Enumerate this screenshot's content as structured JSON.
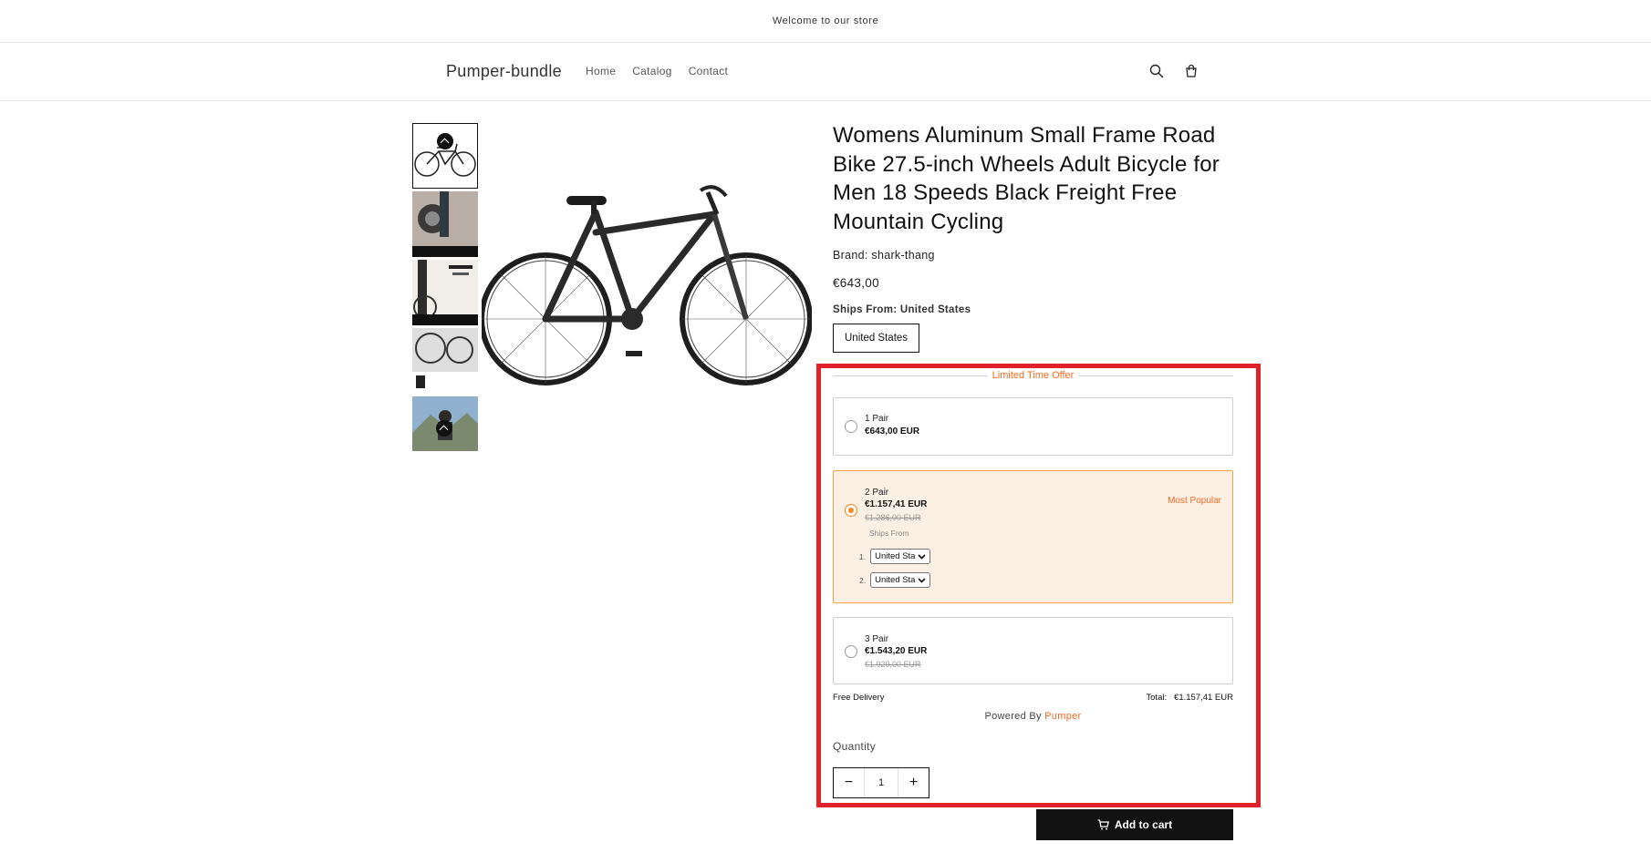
{
  "announcement": {
    "text": "Welcome to our store"
  },
  "header": {
    "logo": "Pumper-bundle",
    "nav": [
      "Home",
      "Catalog",
      "Contact"
    ],
    "icons": [
      "search-icon",
      "cart-icon"
    ]
  },
  "product": {
    "title": "Womens Aluminum Small Frame Road Bike 27.5-inch Wheels Adult Bicycle for Men 18 Speeds Black Freight Free Mountain Cycling",
    "brand": "Brand: shark-thang",
    "price": "€643,00",
    "ships_label": "Ships From: United States",
    "ships_option": "United States"
  },
  "offer": {
    "title": "Limited Time Offer",
    "tiers": [
      {
        "label": "1 Pair",
        "price": "€643,00 EUR",
        "old_price": ""
      },
      {
        "label": "2 Pair",
        "price": "€1.157,41 EUR",
        "old_price": "€1.286,00 EUR",
        "badge": "Most Popular",
        "ships_from": "Ships From",
        "selects": [
          {
            "index": "1.",
            "value": "United Sta"
          },
          {
            "index": "2.",
            "value": "United Sta"
          }
        ]
      },
      {
        "label": "3 Pair",
        "price": "€1.543,20 EUR",
        "old_price": "€1.929,00 EUR"
      }
    ],
    "selected_tier": 1,
    "free_delivery": "Free Delivery",
    "total_label": "Total:",
    "total_value": "€1.157,41 EUR",
    "powered_by": "Powered By",
    "powered_brand": "Pumper"
  },
  "quantity": {
    "label": "Quantity",
    "value": "1",
    "minus": "−",
    "plus": "+"
  },
  "add_to_cart": "Add to cart",
  "colors": {
    "accent": "#f26b21",
    "selected_bg": "#fcefe4",
    "selected_border": "#f5a243",
    "highlight": "#e0232b"
  }
}
